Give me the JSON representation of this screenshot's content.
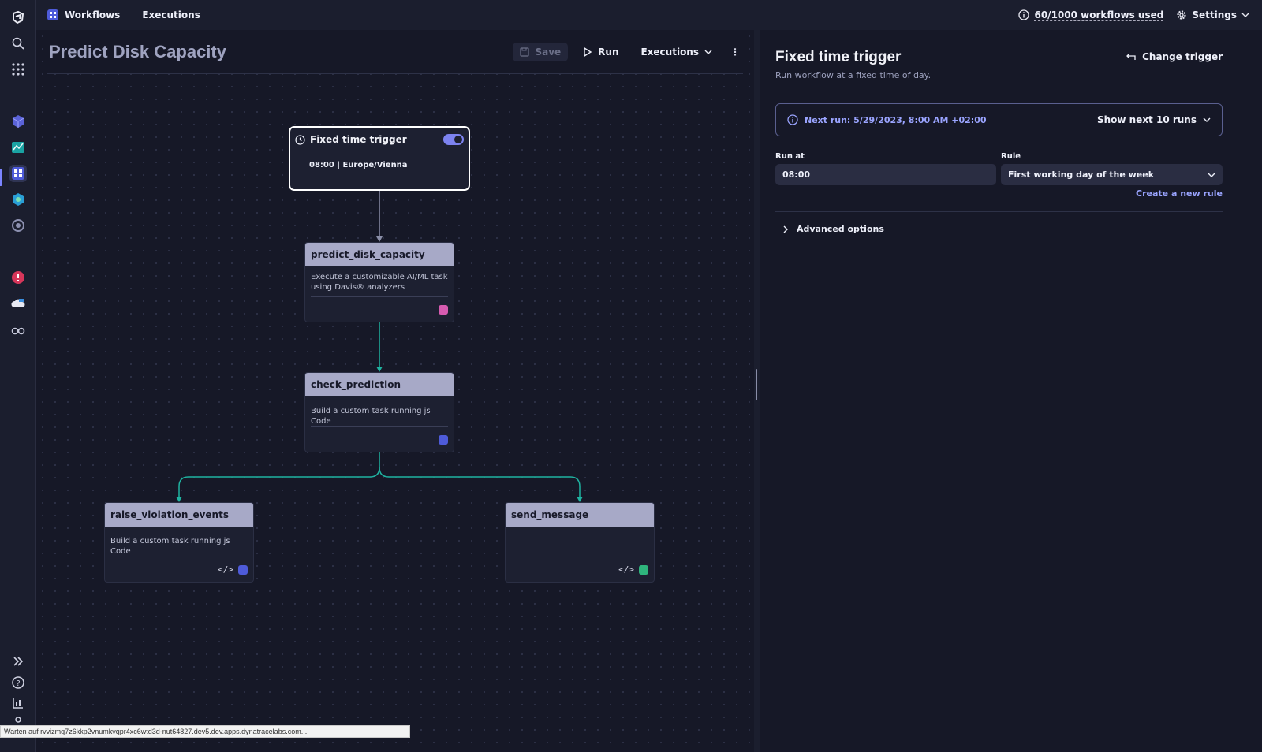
{
  "topbar": {
    "tabs": [
      {
        "label": "Workflows",
        "icon": "workflows-app-icon"
      },
      {
        "label": "Executions"
      }
    ],
    "usage": "60/1000 workflows used",
    "settings": "Settings"
  },
  "editor": {
    "title": "Predict Disk Capacity",
    "save": "Save",
    "run": "Run",
    "executions": "Executions"
  },
  "trigger_node": {
    "title": "Fixed time trigger",
    "enabled": true,
    "schedule": "08:00 | Europe/Vienna"
  },
  "tasks": [
    {
      "name": "predict_disk_capacity",
      "description": "Execute a customizable AI/ML task using Davis® analyzers",
      "icons": [
        "davis-icon"
      ],
      "color": "#d65bb0"
    },
    {
      "name": "check_prediction",
      "description": "Build a custom task running js Code",
      "icons": [
        "workflows-icon"
      ],
      "color": "#4e5bd9"
    },
    {
      "name": "raise_violation_events",
      "description": "Build a custom task running js Code",
      "icons": [
        "code-icon",
        "workflows-icon"
      ],
      "color": "#4e5bd9"
    },
    {
      "name": "send_message",
      "description": "",
      "icons": [
        "code-icon",
        "email-icon"
      ],
      "color": "#2fb57d"
    }
  ],
  "panel": {
    "title": "Fixed time trigger",
    "subtitle": "Run workflow at a fixed time of day.",
    "change_trigger": "Change trigger",
    "next_run": "Next run: 5/29/2023, 8:00 AM +02:00",
    "show_next": "Show next 10 runs",
    "run_at_label": "Run at",
    "run_at_value": "08:00",
    "rule_label": "Rule",
    "rule_value": "First working day of the week",
    "create_rule": "Create a new rule",
    "advanced": "Advanced options"
  },
  "status_bar": "Warten auf rvvizmq7z6kkp2vnumkvqpr4xc6wtd3d-nut64827.dev5.dev.apps.dynatracelabs.com...",
  "colors": {
    "accent": "#7b84ff",
    "connector": "#1fb3a1",
    "node_header": "#a7a9c7"
  }
}
